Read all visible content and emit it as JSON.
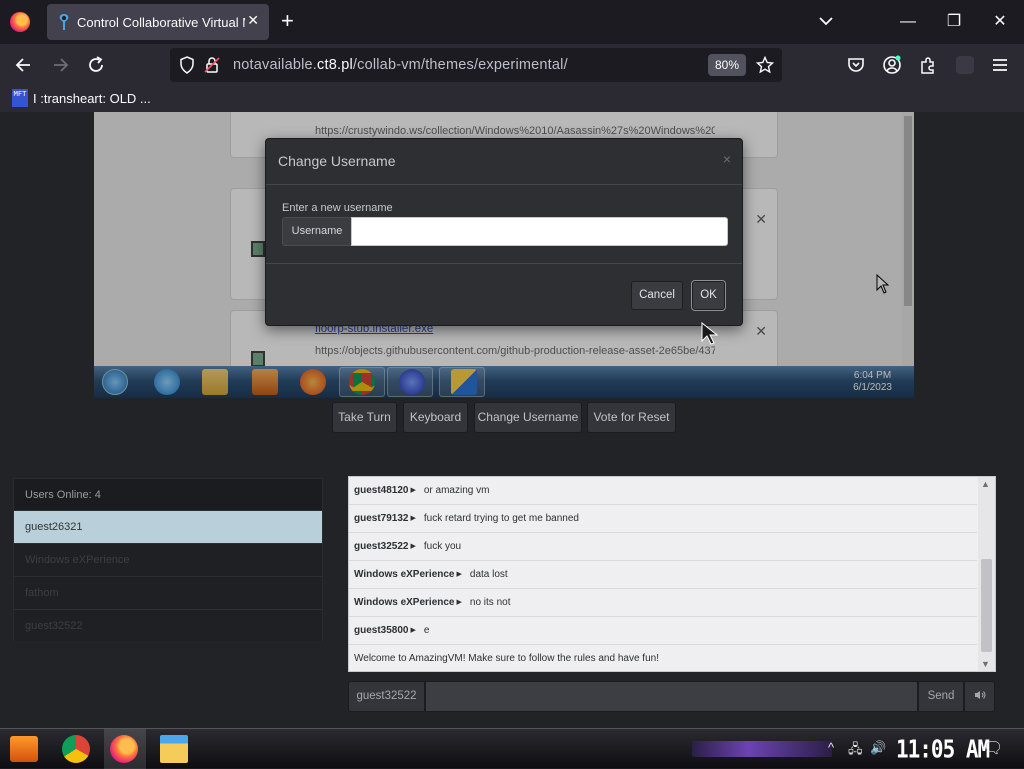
{
  "browser": {
    "tab_title": "Control Collaborative Virtual Machine",
    "url_pre": "notavailable.",
    "url_domain": "ct8.pl",
    "url_path": "/collab-vm/themes/experimental/",
    "zoom": "80%",
    "bookmark_icon_text": "MFT",
    "bookmark_label": "I :transheart: OLD ..."
  },
  "vm": {
    "downloads": [
      {
        "url": "https://crustywindo.ws/collection/Windows%2010/Aasassin%27s%20Windows%201..."
      },
      {
        "name": "floorp-stub.installer.exe",
        "url": "https://objects.githubusercontent.com/github-production-release-asset-2e65be/437..."
      }
    ],
    "clock_time": "6:04 PM",
    "clock_date": "6/1/2023"
  },
  "modal": {
    "title": "Change Username",
    "close": "×",
    "prompt": "Enter a new username",
    "addon_label": "Username",
    "input_value": "",
    "cancel_label": "Cancel",
    "ok_label": "OK"
  },
  "controls": {
    "take_turn": "Take Turn",
    "keyboard": "Keyboard",
    "change_username": "Change Username",
    "vote_reset": "Vote for Reset"
  },
  "users": {
    "header": "Users Online: 4",
    "list": [
      "guest26321",
      "Windows eXPerience",
      "fathom",
      "guest32522"
    ]
  },
  "chat": {
    "messages": [
      {
        "user": "guest48120",
        "text": "or amazing vm"
      },
      {
        "user": "guest79132",
        "text": "fuck retard trying to get me banned"
      },
      {
        "user": "guest32522",
        "text": "fuck you"
      },
      {
        "user": "Windows eXPerience",
        "text": "data lost"
      },
      {
        "user": "Windows eXPerience",
        "text": "no its not"
      },
      {
        "user": "guest35800",
        "text": "e"
      }
    ],
    "welcome": "Welcome to AmazingVM! Make sure to follow the rules and have fun!",
    "current_name": "guest32522",
    "input_value": "",
    "send_label": "Send",
    "audio_icon": "speaker-icon"
  },
  "host": {
    "clock": "11:05 AM"
  }
}
